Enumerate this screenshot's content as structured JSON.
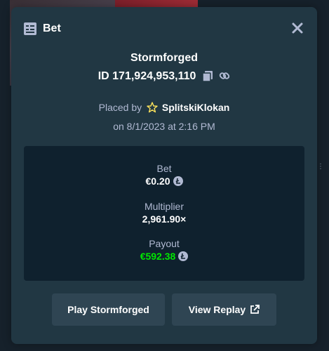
{
  "modal": {
    "title": "Bet",
    "game_name": "Stormforged",
    "bet_id": "ID 171,924,953,110",
    "placed_by_prefix": "Placed by",
    "username": "SplitskiKlokan",
    "date": "on 8/1/2023 at 2:16 PM"
  },
  "stats": {
    "bet_label": "Bet",
    "bet_value": "€0.20",
    "multiplier_label": "Multiplier",
    "multiplier_value": "2,961.90×",
    "payout_label": "Payout",
    "payout_value": "€592.38"
  },
  "buttons": {
    "play_label": "Play Stormforged",
    "replay_label": "View Replay"
  },
  "colors": {
    "modal_bg": "#213743",
    "stats_bg": "#0f212e",
    "button_bg": "#2f4553",
    "payout": "#00e701",
    "muted_text": "#b1bad3",
    "star": "#ffe55c"
  },
  "icons": {
    "header": "bet-slip-icon",
    "close": "close-icon",
    "copy": "copy-icon",
    "link": "link-icon",
    "star": "star-icon",
    "coin": "litecoin-icon",
    "external": "external-link-icon"
  }
}
